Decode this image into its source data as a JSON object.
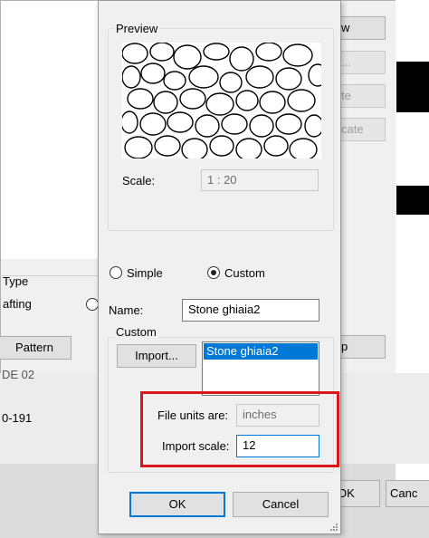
{
  "background": {
    "type_label": "Type",
    "drafting_label": "afting",
    "pattern_button": "Pattern",
    "right_buttons": [
      "w",
      "...",
      "te",
      "cate",
      "p"
    ],
    "list_rows": [
      "DE 02",
      "0-191"
    ],
    "ok_label": "OK",
    "cancel_label": "Canc"
  },
  "dialog": {
    "preview": {
      "title": "Preview",
      "scale_label": "Scale:",
      "scale_value": "1 : 20"
    },
    "type": {
      "simple_label": "Simple",
      "custom_label": "Custom",
      "selected": "Custom"
    },
    "name_label": "Name:",
    "name_value": "Stone ghiaia2",
    "custom": {
      "title": "Custom",
      "import_button": "Import...",
      "files": [
        "Stone ghiaia2"
      ],
      "file_units_label": "File units are:",
      "file_units_value": "inches",
      "import_scale_label": "Import scale:",
      "import_scale_value": "12"
    },
    "ok_button": "OK",
    "cancel_button": "Cancel"
  },
  "colors": {
    "highlight": "#d9161c",
    "selection": "#0078d7"
  }
}
